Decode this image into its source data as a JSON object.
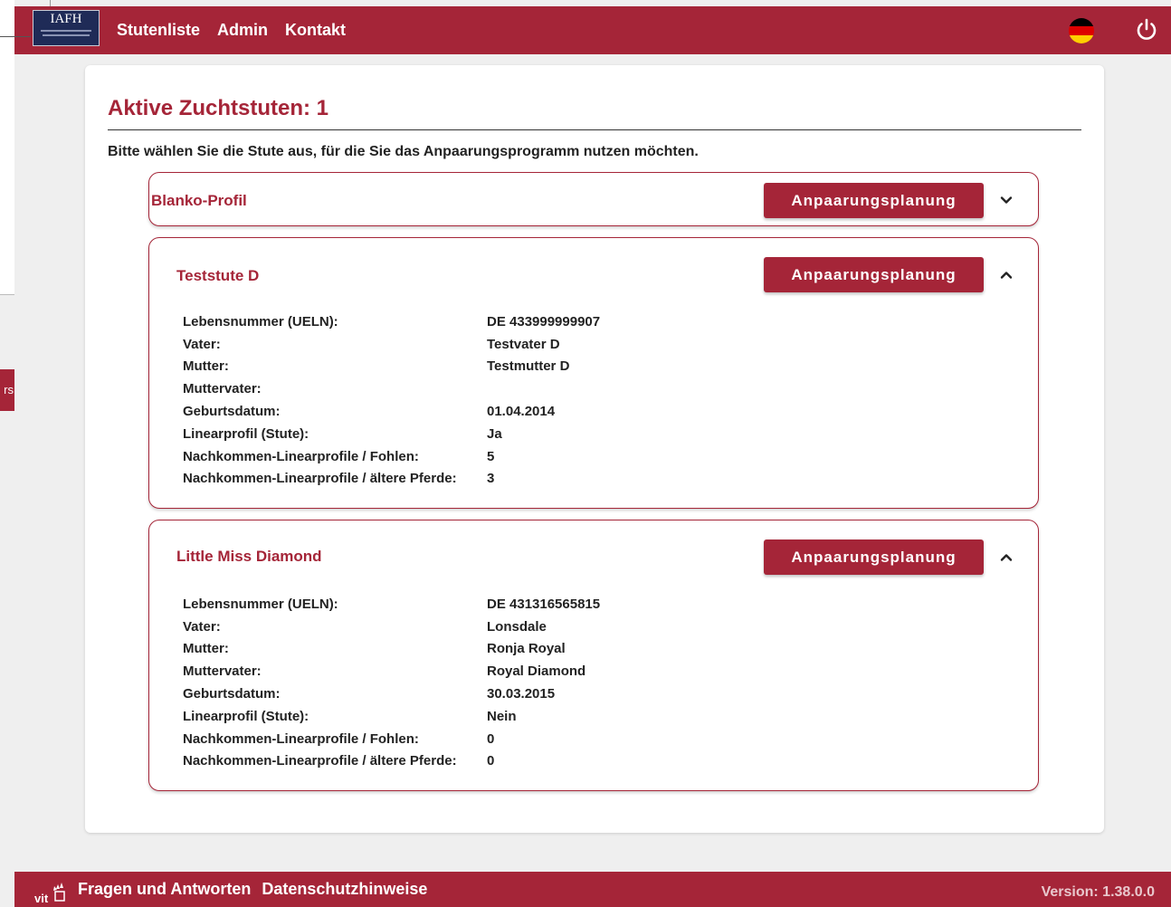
{
  "app": {
    "logo_text": "IAFH"
  },
  "nav": {
    "items": [
      "Stutenliste",
      "Admin",
      "Kontakt"
    ]
  },
  "header": {
    "flag_colors": [
      "#000000",
      "#dd0000",
      "#ffce00"
    ]
  },
  "overlay": {
    "tab_text": "rs"
  },
  "main": {
    "title": "Aktive Zuchtstuten: 1",
    "intro": "Bitte wählen Sie die Stute aus, für die Sie das Anpaarungsprogramm nutzen möchten.",
    "button_label": "Anpaarungsplanung",
    "mares": [
      {
        "name": "Blanko-Profil",
        "expanded": false
      },
      {
        "name": "Teststute D",
        "expanded": true,
        "details": [
          {
            "label": "Lebensnummer (UELN):",
            "value": "DE 433999999907"
          },
          {
            "label": "Vater:",
            "value": "Testvater D"
          },
          {
            "label": "Mutter:",
            "value": "Testmutter D"
          },
          {
            "label": "Muttervater:",
            "value": ""
          },
          {
            "label": "Geburtsdatum:",
            "value": "01.04.2014"
          },
          {
            "label": "Linearprofil (Stute):",
            "value": "Ja"
          },
          {
            "label": "Nachkommen-Linearprofile / Fohlen:",
            "value": "5"
          },
          {
            "label": "Nachkommen-Linearprofile / ältere Pferde:",
            "value": "3"
          }
        ]
      },
      {
        "name": "Little Miss Diamond",
        "expanded": true,
        "details": [
          {
            "label": "Lebensnummer (UELN):",
            "value": "DE 431316565815"
          },
          {
            "label": "Vater:",
            "value": "Lonsdale"
          },
          {
            "label": "Mutter:",
            "value": "Ronja Royal"
          },
          {
            "label": "Muttervater:",
            "value": "Royal Diamond"
          },
          {
            "label": "Geburtsdatum:",
            "value": "30.03.2015"
          },
          {
            "label": "Linearprofil (Stute):",
            "value": "Nein"
          },
          {
            "label": "Nachkommen-Linearprofile / Fohlen:",
            "value": "0"
          },
          {
            "label": "Nachkommen-Linearprofile / ältere Pferde:",
            "value": "0"
          }
        ]
      }
    ]
  },
  "footer": {
    "logo_text": "vit",
    "links": [
      "Fragen und Antworten",
      "Datenschutzhinweise"
    ],
    "version": "Version: 1.38.0.0"
  },
  "colors": {
    "primary": "#a52538",
    "background": "#efefef",
    "card": "#ffffff"
  }
}
